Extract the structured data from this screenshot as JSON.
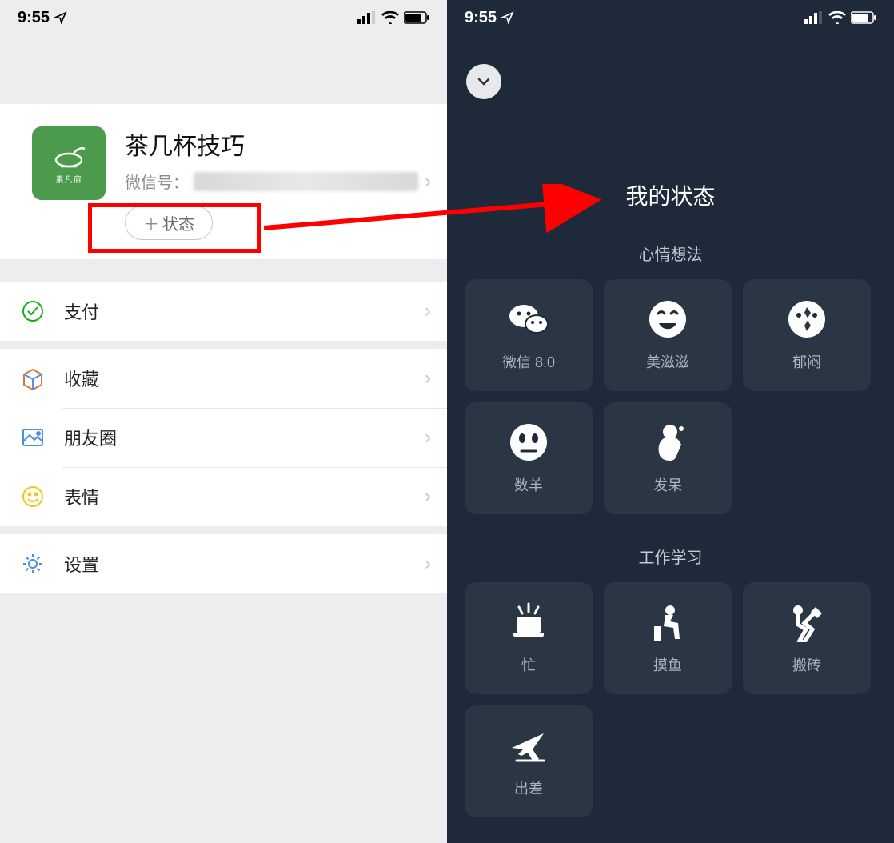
{
  "status_bar": {
    "time": "9:55"
  },
  "left": {
    "profile": {
      "name": "茶几杯技巧",
      "id_label": "微信号：",
      "status_button_label": "状态"
    },
    "menu": {
      "pay": "支付",
      "favorites": "收藏",
      "moments": "朋友圈",
      "stickers": "表情",
      "settings": "设置"
    }
  },
  "right": {
    "title": "我的状态",
    "section1": {
      "title": "心情想法",
      "items": {
        "wechat8": "微信 8.0",
        "happy": "美滋滋",
        "depressed": "郁闷",
        "mehuo": "数羊",
        "daze": "发呆"
      }
    },
    "section2": {
      "title": "工作学习",
      "items": {
        "busy": "忙",
        "slack": "摸鱼",
        "brick": "搬砖",
        "trip": "出差"
      }
    }
  }
}
